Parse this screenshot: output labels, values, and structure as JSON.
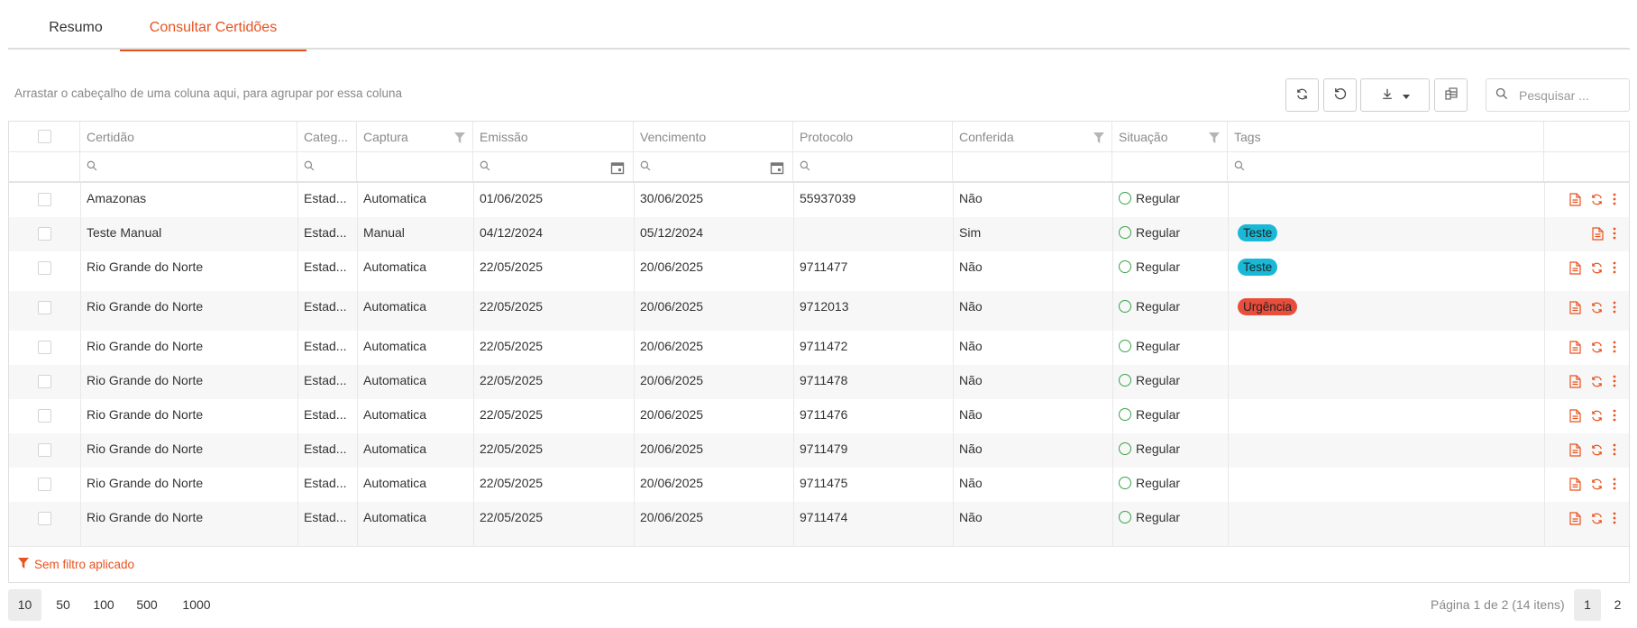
{
  "tabs": [
    {
      "label": "Resumo",
      "active": false
    },
    {
      "label": "Consultar Certidões",
      "active": true
    }
  ],
  "toolbar": {
    "group_hint": "Arrastar o cabeçalho de uma coluna aqui, para agrupar por essa coluna",
    "search_placeholder": "Pesquisar ...",
    "icons": [
      "refresh-icon",
      "reset-icon",
      "download-icon",
      "column-chooser-icon",
      "search-icon"
    ]
  },
  "columns": [
    "",
    "Certidão",
    "Categ...",
    "Captura",
    "Emissão",
    "Vencimento",
    "Protocolo",
    "Conferida",
    "Situação",
    "Tags",
    ""
  ],
  "rows": [
    {
      "certidao": "Amazonas",
      "categoria": "Estad...",
      "captura": "Automatica",
      "emissao": "01/06/2025",
      "vencimento": "30/06/2025",
      "protocolo": "55937039",
      "conferida": "Não",
      "situacao": "Regular",
      "tag": "",
      "actions": [
        "document",
        "refresh",
        "more"
      ]
    },
    {
      "certidao": "Teste Manual",
      "categoria": "Estad...",
      "captura": "Manual",
      "emissao": "04/12/2024",
      "vencimento": "05/12/2024",
      "protocolo": "",
      "conferida": "Sim",
      "situacao": "Regular",
      "tag": "Teste",
      "actions": [
        "document",
        "more"
      ]
    },
    {
      "certidao": "Rio Grande do Norte",
      "categoria": "Estad...",
      "captura": "Automatica",
      "emissao": "22/05/2025",
      "vencimento": "20/06/2025",
      "protocolo": "9711477",
      "conferida": "Não",
      "situacao": "Regular",
      "tag": "Teste",
      "actions": [
        "document",
        "refresh",
        "more"
      ]
    },
    {
      "certidao": "Rio Grande do Norte",
      "categoria": "Estad...",
      "captura": "Automatica",
      "emissao": "22/05/2025",
      "vencimento": "20/06/2025",
      "protocolo": "9712013",
      "conferida": "Não",
      "situacao": "Regular",
      "tag": "Urgência",
      "actions": [
        "document",
        "refresh",
        "more"
      ]
    },
    {
      "certidao": "Rio Grande do Norte",
      "categoria": "Estad...",
      "captura": "Automatica",
      "emissao": "22/05/2025",
      "vencimento": "20/06/2025",
      "protocolo": "9711472",
      "conferida": "Não",
      "situacao": "Regular",
      "tag": "",
      "actions": [
        "document",
        "refresh",
        "more"
      ]
    },
    {
      "certidao": "Rio Grande do Norte",
      "categoria": "Estad...",
      "captura": "Automatica",
      "emissao": "22/05/2025",
      "vencimento": "20/06/2025",
      "protocolo": "9711478",
      "conferida": "Não",
      "situacao": "Regular",
      "tag": "",
      "actions": [
        "document",
        "refresh",
        "more"
      ]
    },
    {
      "certidao": "Rio Grande do Norte",
      "categoria": "Estad...",
      "captura": "Automatica",
      "emissao": "22/05/2025",
      "vencimento": "20/06/2025",
      "protocolo": "9711476",
      "conferida": "Não",
      "situacao": "Regular",
      "tag": "",
      "actions": [
        "document",
        "refresh",
        "more"
      ]
    },
    {
      "certidao": "Rio Grande do Norte",
      "categoria": "Estad...",
      "captura": "Automatica",
      "emissao": "22/05/2025",
      "vencimento": "20/06/2025",
      "protocolo": "9711479",
      "conferida": "Não",
      "situacao": "Regular",
      "tag": "",
      "actions": [
        "document",
        "refresh",
        "more"
      ]
    },
    {
      "certidao": "Rio Grande do Norte",
      "categoria": "Estad...",
      "captura": "Automatica",
      "emissao": "22/05/2025",
      "vencimento": "20/06/2025",
      "protocolo": "9711475",
      "conferida": "Não",
      "situacao": "Regular",
      "tag": "",
      "actions": [
        "document",
        "refresh",
        "more"
      ]
    },
    {
      "certidao": "Rio Grande do Norte",
      "categoria": "Estad...",
      "captura": "Automatica",
      "emissao": "22/05/2025",
      "vencimento": "20/06/2025",
      "protocolo": "9711474",
      "conferida": "Não",
      "situacao": "Regular",
      "tag": "",
      "actions": [
        "document",
        "refresh",
        "more"
      ]
    }
  ],
  "filter_status": "Sem filtro aplicado",
  "page_sizes": [
    {
      "label": "10",
      "selected": true
    },
    {
      "label": "50",
      "selected": false
    },
    {
      "label": "100",
      "selected": false
    },
    {
      "label": "500",
      "selected": false
    },
    {
      "label": "1000",
      "selected": false
    }
  ],
  "pagination": {
    "info": "Página 1 de 2 (14 itens)",
    "pages": [
      {
        "label": "1",
        "selected": true
      },
      {
        "label": "2",
        "selected": false
      }
    ]
  },
  "colors": {
    "accent": "#e8521f",
    "status_ok": "#3aa34a",
    "tag_teste": "#19b8d6",
    "tag_urgencia": "#e94d3c"
  }
}
